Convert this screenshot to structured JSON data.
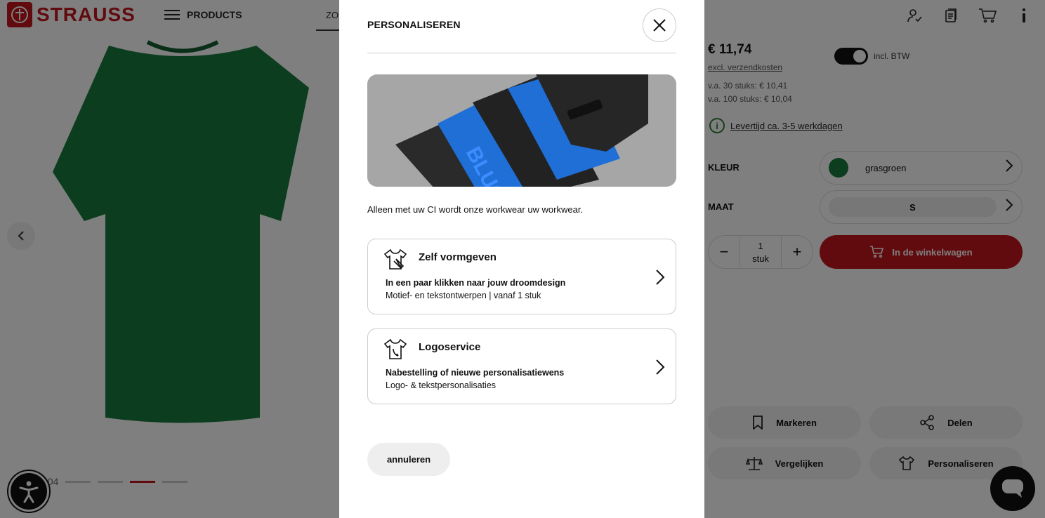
{
  "brand": {
    "name": "STRAUSS",
    "accent_color": "#c3161c"
  },
  "header": {
    "menu_label": "PRODUCTS",
    "search_hint": "ZO",
    "icons": [
      "account-icon",
      "notepad-icon",
      "cart-icon",
      "info-icon"
    ]
  },
  "gallery": {
    "counter_total": "/ 04",
    "active_index": 3,
    "product_color": "#1a7a3e"
  },
  "product": {
    "price": "€ 11,74",
    "shipping_note": "excl. verzendkosten",
    "vat_toggle_label": "incl. BTW",
    "tier_30": "v.a. 30 stuks: € 10,41",
    "tier_100": "v.a. 100 stuks: € 10,04",
    "delivery": "Levertijd ca. 3-5 werkdagen",
    "color_label": "KLEUR",
    "color_value": "grasgroen",
    "size_label": "MAAT",
    "size_value": "S",
    "quantity": "1",
    "quantity_unit": "stuk",
    "add_to_cart": "In de winkelwagen",
    "actions": {
      "bookmark": "Markeren",
      "share": "Delen",
      "compare": "Vergelijken",
      "personalize": "Personaliseren"
    }
  },
  "modal": {
    "title": "PERSONALISEREN",
    "intro": "Alleen met uw CI wordt onze workwear uw workwear.",
    "hero_brand_text": "BLUGAS",
    "options": [
      {
        "title": "Zelf vormgeven",
        "bold": "In een paar klikken naar jouw droomdesign",
        "sub": "Motief- en tekstontwerpen | vanaf 1 stuk",
        "icon": "shirt-design-icon"
      },
      {
        "title": "Logoservice",
        "bold": "Nabestelling of nieuwe personalisatiewens",
        "sub": "Logo- & tekstpersonalisaties",
        "icon": "shirt-logo-icon"
      }
    ],
    "cancel_label": "annuleren"
  }
}
